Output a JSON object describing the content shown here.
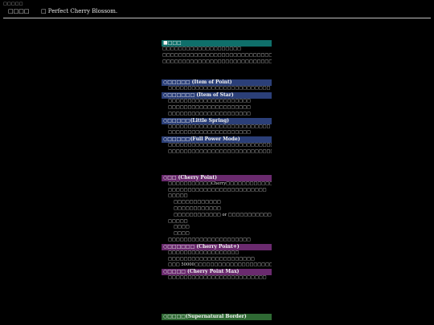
{
  "top": {
    "tiny_text": "□□□□□",
    "title_prefix": "□□□□",
    "icon": "□",
    "title": "Perfect Cherry Blossom."
  },
  "content": {
    "section_main_title": "■□□□",
    "main_lines": [
      "□□□□□□□□□□□□□□□□□□□□",
      "□□□□□□□□□□□□□□□□□□□□□□□□□□□□□□□□□□□",
      "□□□□□□□□□□□□□□□□□□□□□□□□□□□□□"
    ],
    "item_point_title": "○□□□□□ (Item of Point)",
    "item_point_lines": [
      "□□□□□□□□□□□□□□□□□□□□□□□□□□"
    ],
    "item_star_title": "○□□□□□□ (Item of Star)",
    "item_star_lines": [
      "□□□□□□□□□□□□□□□□□□□□□",
      "□□□□□□□□□□□□□□□□□□□□□",
      "□□□□□□□□□□□□□□□□□□□□□"
    ],
    "little_spring_title": "○□□□□□(Little Spring)",
    "little_spring_lines": [
      "□□□□□□□□□□□□□□□□□□□□□□□□□□",
      "□□□□□□□□□□□□□□□□□□□□□"
    ],
    "full_power_title": "○□□□□□(Full Power Mode)",
    "full_power_lines": [
      "□□□□□□□□□□□□□□□□□□□□□□□□□□□□□□□□□□",
      "□□□□□□□□□□□□□□□□□□□□□□□□□□□□"
    ],
    "cherry_point_title": "○□□ (Cherry Point)",
    "cherry_point_lines": [
      "□□□□□□□□□□□Cherry□□□□□□□□□□□□□□□□",
      "□□□□□□□□□□□□□□□□□□□□□□□□□",
      "□□□□□",
      "□□□□□□□□□□□□",
      "□□□□□□□□□□□□",
      "□□□□□□□□□□□□ or □□□□□□□□□□□□□□□",
      "□□□□□",
      "□□□□",
      "□□□□",
      "□□□□□□□□□□□□□□□□□□□□□"
    ],
    "cherry_point_plus_title": "○□□□□□□ (Cherry Point+)",
    "cherry_point_plus_lines": [
      "□□□□□□□□□□□□□□□□□□",
      "□□□□□□□□□□□□□□□□□□□□□□",
      "□□□ 50000□□□□□□□□□□□□□□□□□□□□□"
    ],
    "cherry_point_max_title": "○□□□□ (Cherry Point Max)",
    "cherry_point_max_lines": [
      "□□□□□□□□□□□□□□□□□□□□□□□□□"
    ],
    "supernatural_title": "○□□□□(Supernatural Border)"
  }
}
